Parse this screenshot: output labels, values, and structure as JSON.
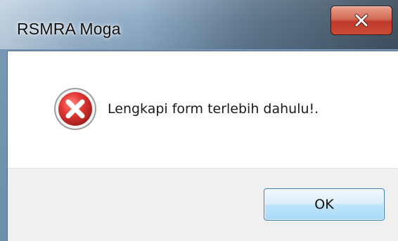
{
  "window": {
    "title": "RSMRA Moga",
    "close_icon": "close-icon"
  },
  "dialog": {
    "icon": "error-icon",
    "message": "Lengkapi form terlebih dahulu!.",
    "ok_label": "OK"
  },
  "colors": {
    "frame": "#87a5c1",
    "close_button": "#c0392b",
    "error_red": "#d32f2f",
    "ok_button": "#bee4fb",
    "footer": "#f0f0f0"
  }
}
